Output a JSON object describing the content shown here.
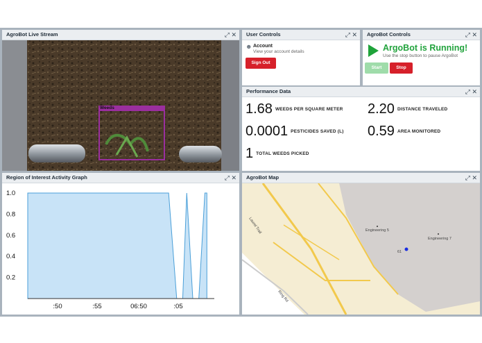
{
  "panels": {
    "stream": {
      "title": "AgroBot Live Stream",
      "detection_label": "Weeds"
    },
    "user": {
      "title": "User Controls",
      "account_title": "Account",
      "account_sub": "View your account details",
      "signout": "Sign Out"
    },
    "argobot": {
      "title": "AgroBot Controls",
      "status": "ArgoBot is Running!",
      "sub": "Use the stop button to pause ArgoBot",
      "start": "Start",
      "stop": "Stop"
    },
    "perf": {
      "title": "Performance Data",
      "metrics": [
        {
          "value": "1.68",
          "label": "WEEDS PER SQUARE METER"
        },
        {
          "value": "2.20",
          "label": "DISTANCE TRAVELED"
        },
        {
          "value": "0.0001",
          "label": "PESTICIDES SAVED (L)"
        },
        {
          "value": "0.59",
          "label": "AREA MONITORED"
        },
        {
          "value": "1",
          "label": "TOTAL WEEDS PICKED"
        }
      ]
    },
    "graph": {
      "title": "Region of Interest Activity Graph"
    },
    "map": {
      "title": "AgroBot Map",
      "labels": {
        "eng5": "Engineering 5",
        "eng7": "Engineering 7",
        "laurel": "Laurel Trail",
        "ring": "Ring Rd",
        "num": "61"
      }
    }
  },
  "controls": {
    "expand": "⤢",
    "close": "✕"
  },
  "colors": {
    "accent_green": "#22a33d",
    "stop_red": "#d6202a",
    "start_disabled": "#9fdcaa",
    "fill": "#c8e3f7",
    "stroke": "#4a9fd8"
  },
  "chart_data": {
    "type": "area",
    "x_ticks": [
      ":50",
      ":55",
      "06:50",
      ":05"
    ],
    "y_ticks": [
      "0.2",
      "0.4",
      "0.6",
      "0.8",
      "1.0"
    ],
    "ylim": [
      0,
      1.0
    ],
    "series": [
      {
        "values": [
          [
            0,
            1.0
          ],
          [
            70,
            1.0
          ],
          [
            74,
            0.0
          ],
          [
            77,
            0.0
          ],
          [
            79,
            1.0
          ],
          [
            82,
            0.0
          ],
          [
            85,
            0.0
          ],
          [
            88,
            1.0
          ],
          [
            89,
            1.0
          ]
        ]
      }
    ],
    "xlim": [
      0,
      92
    ]
  }
}
